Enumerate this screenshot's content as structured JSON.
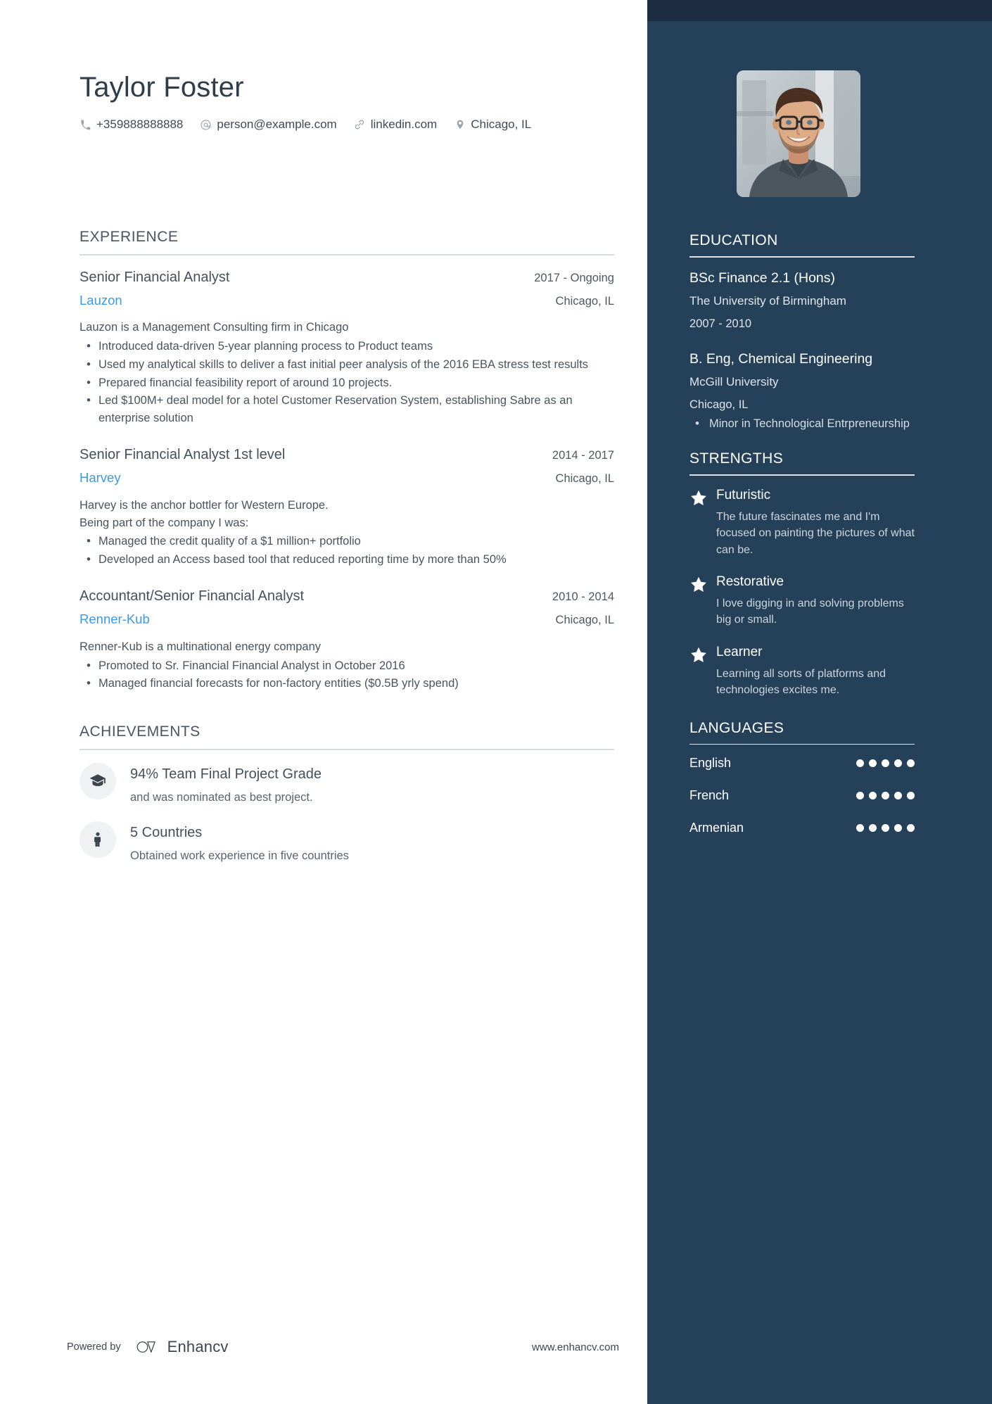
{
  "theme": {
    "sidebar_bg": "#254059",
    "sidebar_top_strip": "#1c2d41",
    "accent_link": "#3b9ae8",
    "text_dark": "#44505c",
    "rule_light": "#d9dcdf"
  },
  "header": {
    "full_name": "Taylor Foster",
    "contacts": [
      {
        "icon": "phone-icon",
        "value": "+359888888888"
      },
      {
        "icon": "at-icon",
        "value": "person@example.com"
      },
      {
        "icon": "link-icon",
        "value": "linkedin.com"
      },
      {
        "icon": "location-pin-icon",
        "value": "Chicago, IL"
      }
    ]
  },
  "experience": {
    "title": "EXPERIENCE",
    "jobs": [
      {
        "title": "Senior Financial Analyst",
        "dates": "2017 - Ongoing",
        "company": "Lauzon",
        "location": "Chicago, IL",
        "description": "Lauzon is a Management Consulting firm in Chicago",
        "bullets": [
          "Introduced data-driven 5-year planning process to Product teams",
          "Used my analytical skills to deliver a fast initial peer analysis of the 2016 EBA stress test results",
          "Prepared financial feasibility report of around 10 projects.",
          "Led $100M+ deal model for a hotel Customer Reservation System, establishing Sabre as an enterprise solution"
        ]
      },
      {
        "title": "Senior Financial Analyst 1st level",
        "dates": "2014 - 2017",
        "company": "Harvey",
        "location": "Chicago, IL",
        "description": "Harvey is the anchor bottler for Western Europe.\nBeing part of the company I was:",
        "bullets": [
          "Managed the credit quality of a $1 million+ portfolio",
          "Developed an Access based tool that reduced reporting time by more than 50%"
        ]
      },
      {
        "title": "Accountant/Senior Financial Analyst",
        "dates": "2010 - 2014",
        "company": "Renner-Kub",
        "location": "Chicago, IL",
        "description": "Renner-Kub is a multinational energy company",
        "bullets": [
          "Promoted to Sr. Financial Financial Analyst in October 2016",
          "Managed financial forecasts for non-factory entities ($0.5B yrly spend)"
        ]
      }
    ]
  },
  "achievements": {
    "title": "ACHIEVEMENTS",
    "items": [
      {
        "icon": "graduation-cap-icon",
        "title": "94% Team Final Project Grade",
        "description": "and was nominated as best project."
      },
      {
        "icon": "person-icon",
        "title": "5 Countries",
        "description": "Obtained work experience in five countries"
      }
    ]
  },
  "sidebar": {
    "education": {
      "title": "EDUCATION",
      "entries": [
        {
          "degree": "BSc Finance 2.1 (Hons)",
          "school": "The University of Birmingham",
          "meta": "2007 - 2010",
          "bullets": []
        },
        {
          "degree": "B. Eng, Chemical Engineering",
          "school": "McGill University",
          "meta": "Chicago, IL",
          "bullets": [
            "Minor in Technological Entrpreneurship"
          ]
        }
      ]
    },
    "strengths": {
      "title": "STRENGTHS",
      "items": [
        {
          "icon": "star-icon",
          "name": "Futuristic",
          "description": "The future fascinates me and I'm focused on painting the pictures of what can be."
        },
        {
          "icon": "star-icon",
          "name": "Restorative",
          "description": "I love digging in and solving problems big or small."
        },
        {
          "icon": "star-icon",
          "name": "Learner",
          "description": "Learning all sorts of platforms and technologies excites me."
        }
      ]
    },
    "languages": {
      "title": "LANGUAGES",
      "max_level": 5,
      "items": [
        {
          "name": "English",
          "level": 5
        },
        {
          "name": "French",
          "level": 5
        },
        {
          "name": "Armenian",
          "level": 5
        }
      ]
    }
  },
  "footer": {
    "powered_by": "Powered by",
    "brand": "Enhancv",
    "url": "www.enhancv.com"
  }
}
